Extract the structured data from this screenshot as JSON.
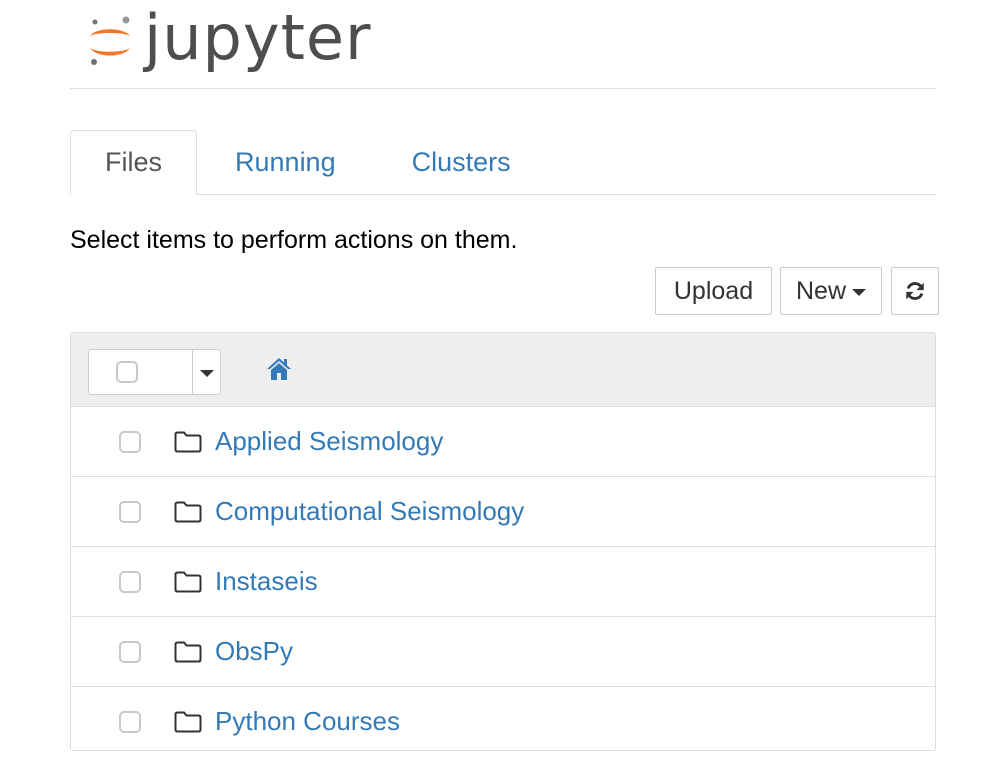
{
  "app": {
    "logo_text": "jupyter"
  },
  "tabs": [
    {
      "label": "Files",
      "active": true
    },
    {
      "label": "Running",
      "active": false
    },
    {
      "label": "Clusters",
      "active": false
    }
  ],
  "instructions": "Select items to perform actions on them.",
  "toolbar": {
    "upload_label": "Upload",
    "new_label": "New",
    "refresh_icon": "refresh-icon"
  },
  "file_list": {
    "home_icon": "home-icon",
    "items": [
      {
        "name": "Applied Seismology",
        "type": "folder",
        "checked": false
      },
      {
        "name": "Computational Seismology",
        "type": "folder",
        "checked": false
      },
      {
        "name": "Instaseis",
        "type": "folder",
        "checked": false
      },
      {
        "name": "ObsPy",
        "type": "folder",
        "checked": false
      },
      {
        "name": "Python Courses",
        "type": "folder",
        "checked": false
      }
    ]
  },
  "colors": {
    "link": "#337ab7",
    "logo_orange": "#f37726",
    "logo_text": "#4e4e4e",
    "header_bg": "#eeeeee",
    "border": "#dddddd"
  }
}
